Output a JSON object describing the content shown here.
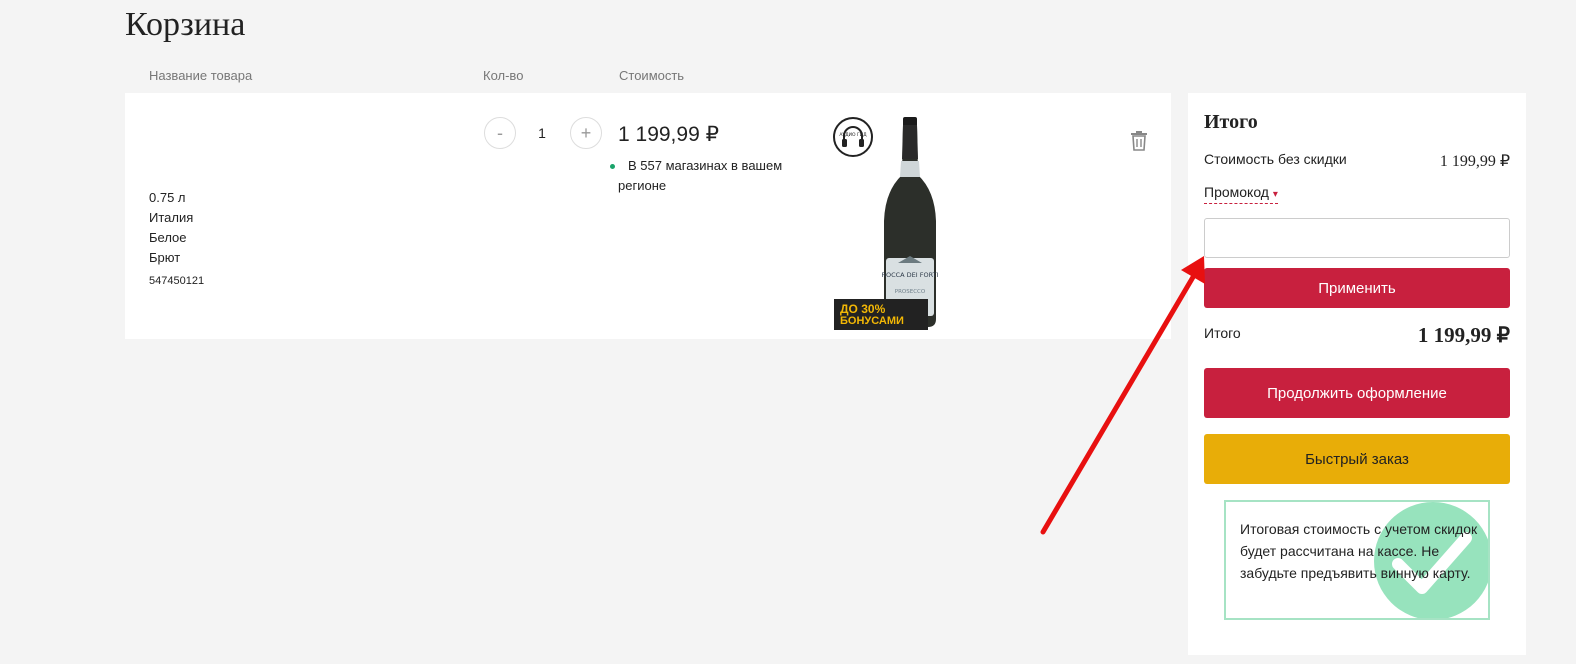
{
  "page": {
    "title": "Корзина"
  },
  "columns": {
    "name": "Название товара",
    "qty": "Кол-во",
    "cost": "Стоимость"
  },
  "cart_item": {
    "volume": "0.75 л",
    "country": "Италия",
    "color": "Белое",
    "sweetness": "Брют",
    "sku": "547450121",
    "quantity": "1",
    "minus_label": "-",
    "plus_label": "+",
    "price": "1 199,99 ₽",
    "stock_text": "В 557 магазинах в вашем регионе",
    "stock_color": "#1aa36a",
    "bottle_label": "ROCCA DEI FORTI",
    "bottle_sublabel": "PROSECCO",
    "audio_badge": "АУДИО ГИД",
    "bonus_line1": "ДО 30%",
    "bonus_line2": "БОНУСАМИ",
    "bonus_color": "#f2b705"
  },
  "summary": {
    "title": "Итого",
    "subtotal_label": "Стоимость без скидки",
    "subtotal_value": "1 199,99 ₽",
    "promo_label": "Промокод",
    "promo_caret": "▾",
    "promo_placeholder": "",
    "apply_label": "Применить",
    "total_label": "Итого",
    "total_value": "1 199,99 ₽",
    "checkout_label": "Продолжить оформление",
    "quick_order_label": "Быстрый заказ",
    "notice_text": "Итоговая стоимость с учетом скидок будет рассчитана на кассе. Не забудьте предъявить винную карту.",
    "accent_color": "#c8203e",
    "quick_color": "#e8ad08"
  }
}
